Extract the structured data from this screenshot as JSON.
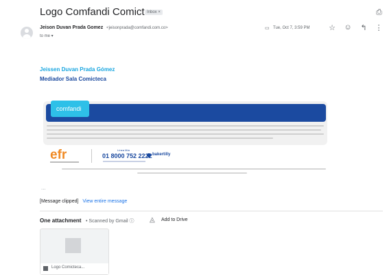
{
  "email": {
    "subject": "Logo Comfandi Comicteca",
    "label": "Inbox ×",
    "sender_name": "Jeison Duvan Prada Gomez",
    "sender_email": "<jeisonprada@comfandi.com.co>",
    "recipient": "to me ▾",
    "date": "Tue, Oct 7, 3:59 PM"
  },
  "icons": {
    "print": "print-icon",
    "label_tag": "label-icon",
    "star": "star-icon",
    "emoji": "emoji-icon",
    "reply": "reply-icon",
    "more": "more-vert-icon",
    "drive": "drive-icon",
    "info": "info-icon",
    "file": "image-file-icon"
  },
  "signature": {
    "name": "Jeissen Duvan Prada Gómez",
    "role": "Mediador Sala Comicteca",
    "brand": "comfandi",
    "brand_color": "#1b4aa0",
    "logo_color": "#2ec0e8",
    "efr_logo": "efr",
    "efr_color": "#f08a24",
    "line_label": "Línea Mía",
    "phone": "01 8000 752 2222",
    "partner": "bakertilly"
  },
  "body": {
    "ellipsis": "...",
    "clipped_text": "[Message clipped]",
    "view_entire": "View entire message"
  },
  "attachments": {
    "header": "One attachment",
    "scanned": "•  Scanned by Gmail ⓘ",
    "add_to_drive": "Add to Drive",
    "files": [
      {
        "name": "Logo Comicteca..."
      }
    ]
  }
}
